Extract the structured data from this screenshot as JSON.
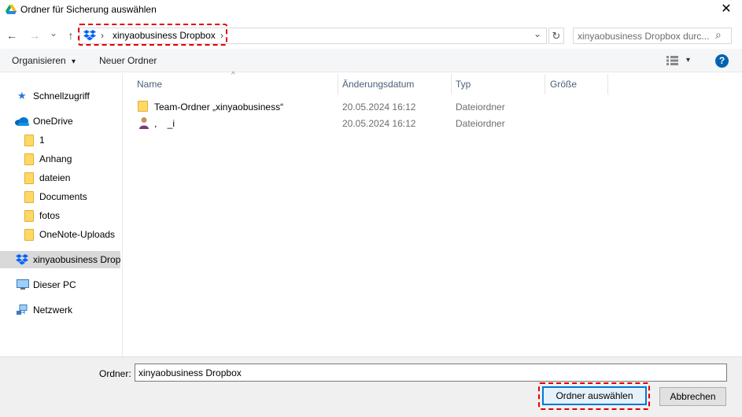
{
  "window": {
    "title": "Ordner für Sicherung auswählen",
    "close_glyph": "✕",
    "app_icon": "google-drive-icon"
  },
  "navigation": {
    "back_glyph": "←",
    "forward_glyph": "→",
    "recent_glyph": "⌄",
    "up_glyph": "↑",
    "breadcrumb_separator": "›",
    "breadcrumb": [
      "xinyaobusiness Dropbox"
    ],
    "breadcrumb_trailing": "›",
    "dropdown_glyph": "⌄",
    "refresh_glyph": "↻",
    "search_placeholder": "xinyaobusiness Dropbox durc...",
    "search_glyph": "⌕"
  },
  "toolbar": {
    "organize_label": "Organisieren",
    "organize_arrow": "▾",
    "new_folder_label": "Neuer Ordner",
    "view_arrow": "▾",
    "help_glyph": "?"
  },
  "sidebar": {
    "items": [
      {
        "label": "Schnellzugriff",
        "icon": "star-icon"
      },
      {
        "label": "OneDrive",
        "icon": "cloud-icon"
      },
      {
        "label": "1",
        "icon": "folder-icon"
      },
      {
        "label": "Anhang",
        "icon": "folder-icon"
      },
      {
        "label": "dateien",
        "icon": "folder-icon"
      },
      {
        "label": "Documents",
        "icon": "folder-icon"
      },
      {
        "label": "fotos",
        "icon": "folder-icon"
      },
      {
        "label": "OneNote-Uploads",
        "icon": "folder-icon"
      },
      {
        "label": "xinyaobusiness Dropb",
        "icon": "dropbox-icon",
        "selected": true
      },
      {
        "label": "Dieser PC",
        "icon": "computer-icon"
      },
      {
        "label": "Netzwerk",
        "icon": "network-icon"
      }
    ]
  },
  "file_list": {
    "sort_glyph": "^",
    "columns": [
      "Name",
      "Änderungsdatum",
      "Typ",
      "Größe"
    ],
    "rows": [
      {
        "name": "Team-Ordner „xinyaobusiness“",
        "date": "20.05.2024 16:12",
        "type": "Dateiordner",
        "size": "",
        "icon": "folder-icon"
      },
      {
        "name": ",    _i",
        "date": "20.05.2024 16:12",
        "type": "Dateiordner",
        "size": "",
        "icon": "user-folder-icon"
      }
    ]
  },
  "footer": {
    "folder_label": "Ordner:",
    "folder_value": "xinyaobusiness Dropbox",
    "select_button": "Ordner auswählen",
    "cancel_button": "Abbrechen"
  },
  "colors": {
    "highlight": "#e00000",
    "dropbox": "#0061fe",
    "accent": "#0078d7"
  }
}
